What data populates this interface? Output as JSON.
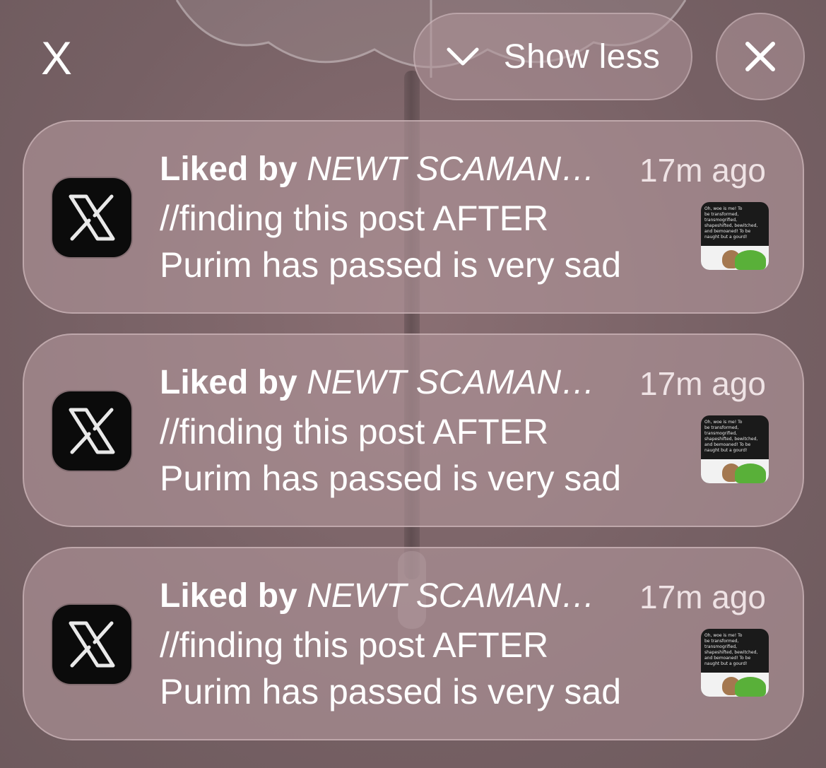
{
  "group": {
    "app_name": "X",
    "show_less_label": "Show less",
    "show_less_icon": "chevron-down-icon",
    "close_icon": "close-icon"
  },
  "notifications": [
    {
      "app_icon": "x-logo-icon",
      "title_lead": "Liked by",
      "title_name": "NEWT SCAMAN…",
      "time": "17m ago",
      "body_line1": "//finding this post AFTER",
      "body_line2": "Purim has passed is very sad",
      "thumbnail_text": [
        "Oh, woe is me! To",
        "be transformed,",
        "transmogrified,",
        "shapeshifted, bewitched,",
        "and bemoaned! To be",
        "naught but a gourd!"
      ]
    },
    {
      "app_icon": "x-logo-icon",
      "title_lead": "Liked by",
      "title_name": "NEWT SCAMAN…",
      "time": "17m ago",
      "body_line1": "//finding this post AFTER",
      "body_line2": "Purim has passed is very sad",
      "thumbnail_text": [
        "Oh, woe is me! To",
        "be transformed,",
        "transmogrified,",
        "shapeshifted, bewitched,",
        "and bemoaned! To be",
        "naught but a gourd!"
      ]
    },
    {
      "app_icon": "x-logo-icon",
      "title_lead": "Liked by",
      "title_name": "NEWT SCAMAN…",
      "time": "17m ago",
      "body_line1": "//finding this post AFTER",
      "body_line2": "Purim has passed is very sad",
      "thumbnail_text": [
        "Oh, woe is me! To",
        "be transformed,",
        "transmogrified,",
        "shapeshifted, bewitched,",
        "and bemoaned! To be",
        "naught but a gourd!"
      ]
    }
  ],
  "colors": {
    "background": "#7a6165",
    "card": "#b2969b",
    "text": "#ffffff",
    "icon_bg": "#0b0b0b",
    "gourd_green": "#59b039"
  }
}
